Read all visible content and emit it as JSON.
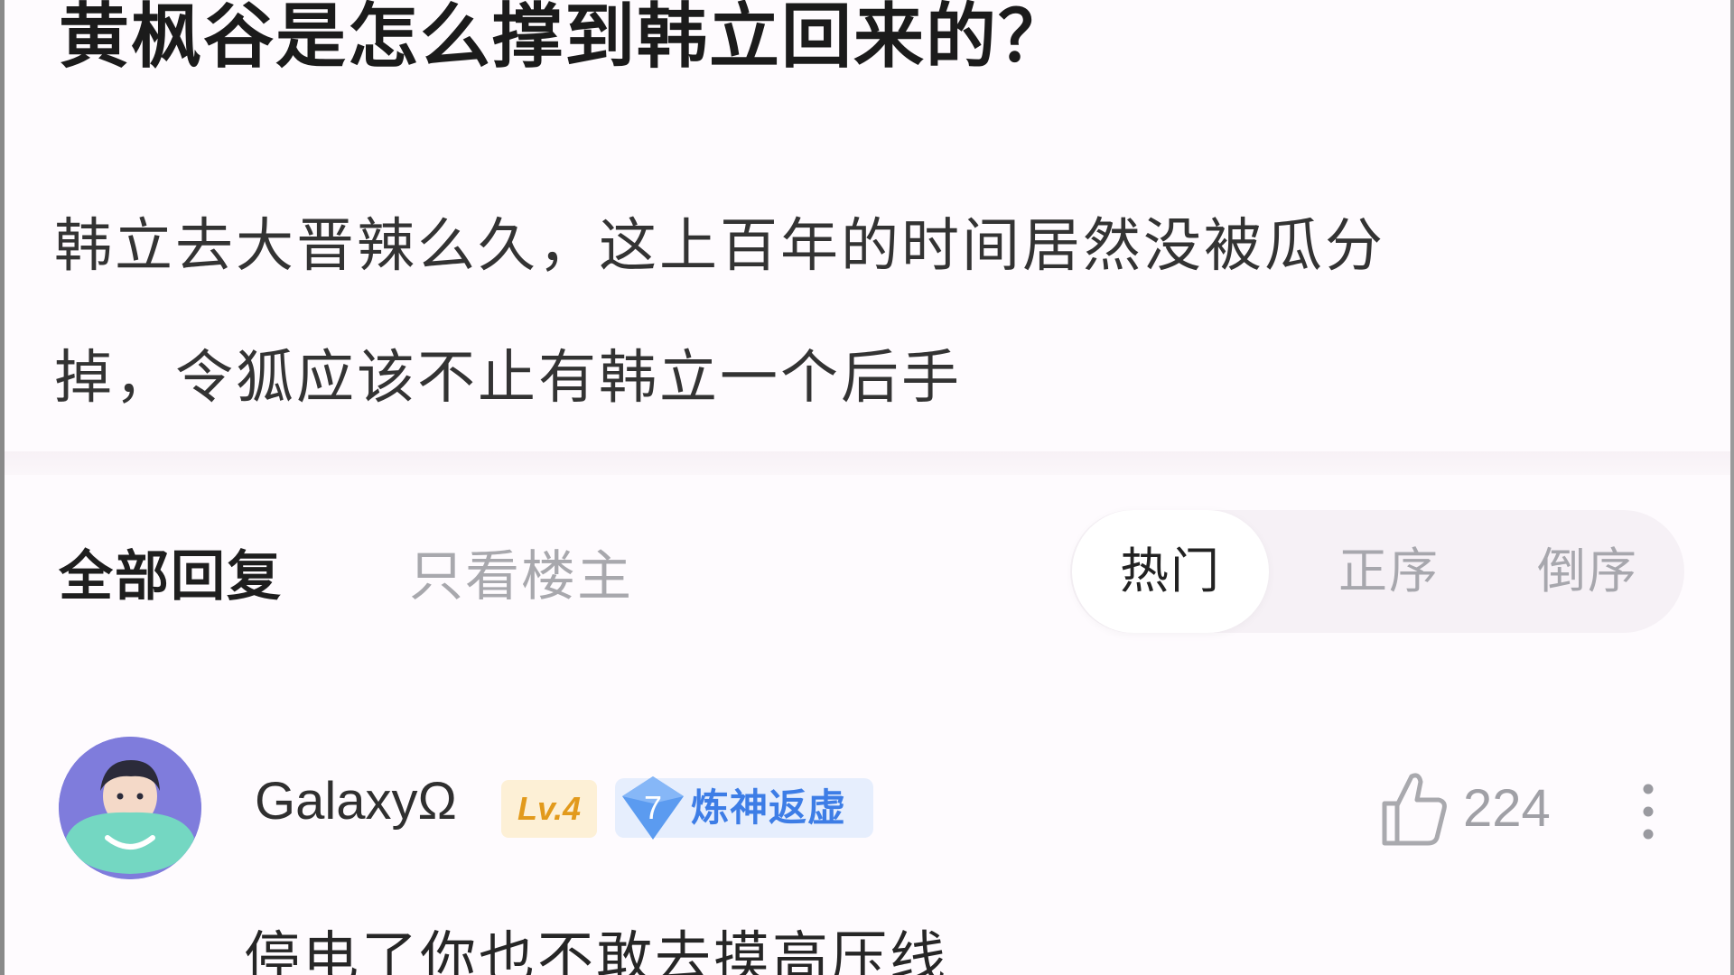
{
  "post": {
    "title": "黄枫谷是怎么撑到韩立回来的？",
    "body_lines": [
      "韩立去大晋辣么久，这上百年的时间居然没被瓜分",
      "掉，令狐应该不止有韩立一个后手"
    ]
  },
  "filters": {
    "all_replies": "全部回复",
    "only_op": "只看楼主",
    "sort_options": [
      "热门",
      "正序",
      "倒序"
    ],
    "active_sort": "热门"
  },
  "comments": [
    {
      "username": "GalaxyΩ",
      "level": "Lv.4",
      "title_badge_number": "7",
      "title_badge": "炼神返虚",
      "like_icon": "thumbs-up-icon",
      "like_count": "224",
      "more_icon": "more-vertical-icon",
      "text": "停电了你也不敢去摸高压线"
    }
  ],
  "colors": {
    "background": "#fefbfe",
    "title_text": "#1b1b1b",
    "muted_text": "#a8a8ad",
    "level_badge": "#e29a1c",
    "title_badge": "#3d7de6"
  }
}
